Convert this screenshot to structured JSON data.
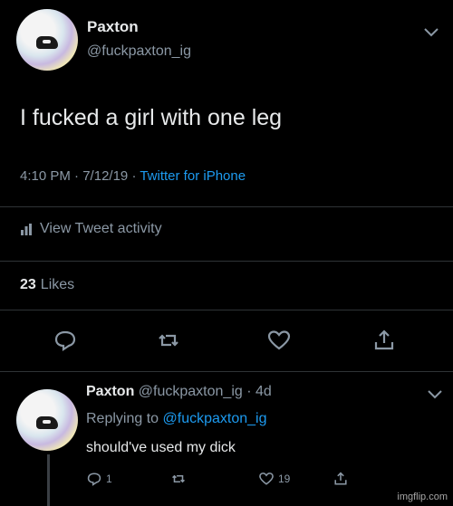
{
  "tweet": {
    "author_name": "Paxton",
    "author_handle": "@fuckpaxton_ig",
    "text": "I fucked a girl with one leg",
    "time": "4:10 PM",
    "date": "7/12/19",
    "source": "Twitter for iPhone",
    "activity_label": "View Tweet activity",
    "likes_count": "23",
    "likes_label": "Likes"
  },
  "reply": {
    "author_name": "Paxton",
    "author_handle": "@fuckpaxton_ig",
    "age": "4d",
    "replying_label": "Replying to",
    "replying_to": "@fuckpaxton_ig",
    "text": "should've used my dick",
    "reply_count": "1",
    "like_count": "19"
  },
  "watermark": "imgflip.com",
  "icons": [
    "chevron-down-icon",
    "chart-icon",
    "reply-icon",
    "retweet-icon",
    "heart-icon",
    "share-icon"
  ],
  "colors": {
    "background": "#000000",
    "link": "#1d9bf0",
    "secondary": "#8b98a5",
    "text": "#e7e9ea"
  }
}
